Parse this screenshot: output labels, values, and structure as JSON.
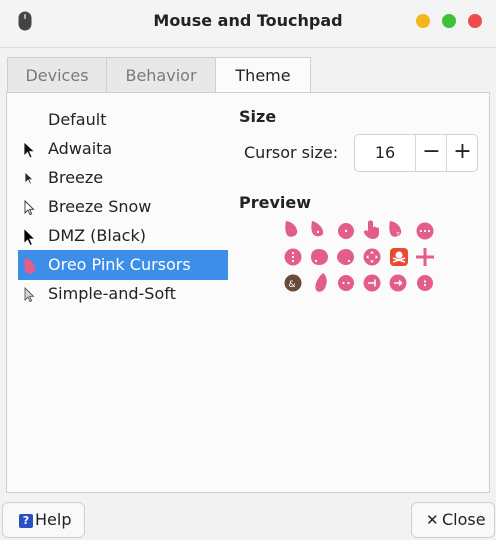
{
  "window": {
    "title": "Mouse and Touchpad",
    "app_icon": "mouse-icon",
    "controls": {
      "minimize_color": "#f5b51d",
      "maximize_color": "#3dc23b",
      "close_color": "#ef4c4c"
    }
  },
  "tabs": [
    {
      "label": "Devices",
      "active": false
    },
    {
      "label": "Behavior",
      "active": false
    },
    {
      "label": "Theme",
      "active": true
    }
  ],
  "cursor_themes": [
    {
      "label": "Default",
      "icon": "none",
      "selected": false
    },
    {
      "label": "Adwaita",
      "icon": "black-arrow-icon",
      "selected": false
    },
    {
      "label": "Breeze",
      "icon": "dark-arrow-icon",
      "selected": false
    },
    {
      "label": "Breeze Snow",
      "icon": "white-arrow-icon",
      "selected": false
    },
    {
      "label": "DMZ (Black)",
      "icon": "black-arrow-icon",
      "selected": false
    },
    {
      "label": "Oreo Pink Cursors",
      "icon": "pink-cursor-icon",
      "selected": true
    },
    {
      "label": "Simple-and-Soft",
      "icon": "gray-arrow-icon",
      "selected": false
    }
  ],
  "size": {
    "title": "Size",
    "cursor_size_label": "Cursor size:",
    "value": "16",
    "decrease_symbol": "−",
    "increase_symbol": "+"
  },
  "preview": {
    "title": "Preview",
    "accent_color": "#e25d8a",
    "icons": [
      [
        "pointer-icon",
        "pointer-right-icon",
        "dot-icon",
        "hand-icon",
        "help-icon",
        "progress-icon"
      ],
      [
        "vertical-dots-icon",
        "drop-icon",
        "corner-icon",
        "move-icon",
        "pirate-icon",
        "crosshair-icon"
      ],
      [
        "not-allowed-icon",
        "pen-icon",
        "h-dots-icon",
        "resize-left-icon",
        "resize-right-icon",
        "small-dot-icon"
      ]
    ]
  },
  "footer": {
    "help_label": "Help",
    "close_label": "Close"
  }
}
